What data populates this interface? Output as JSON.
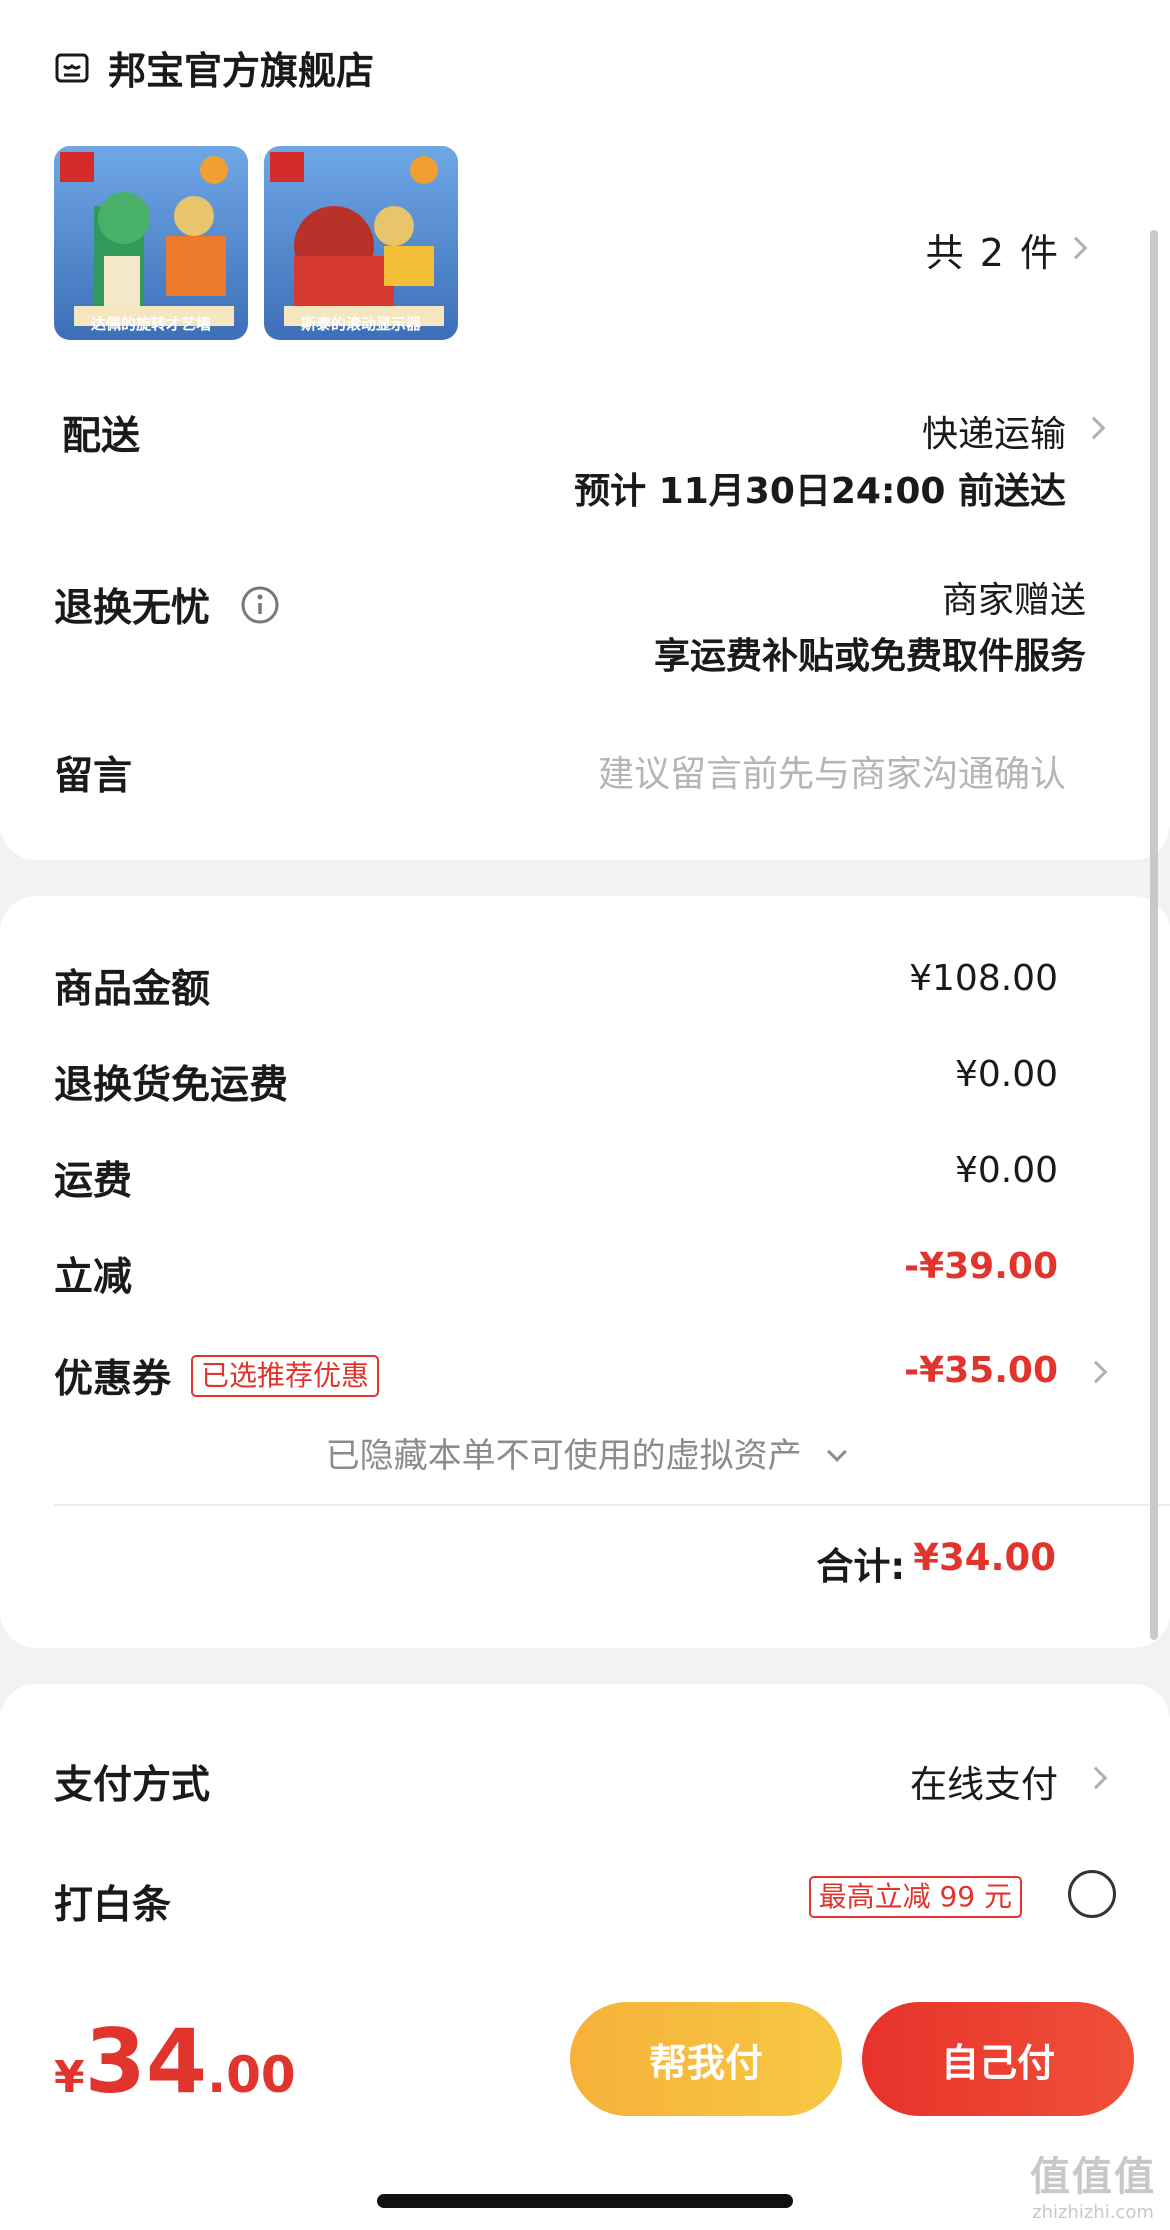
{
  "store": {
    "name": "邦宝官方旗舰店",
    "icon": "store-icon"
  },
  "products": {
    "items": [
      {
        "caption": "达佩的旋转才艺墙",
        "bg": "#4a7fc4"
      },
      {
        "caption": "斯泰的滚动显示器",
        "bg": "#4a7fc4"
      }
    ],
    "count_label": "共",
    "count": "2",
    "count_unit": "件"
  },
  "delivery": {
    "label": "配送",
    "method": "快递运输",
    "eta": "预计 11月30日24:00 前送达"
  },
  "returns": {
    "label": "退换无忧",
    "value": "商家赠送",
    "desc": "享运费补贴或免费取件服务"
  },
  "message": {
    "label": "留言",
    "placeholder": "建议留言前先与商家沟通确认"
  },
  "price": {
    "goods_label": "商品金额",
    "goods_value": "¥108.00",
    "return_ship_label": "退换货免运费",
    "return_ship_value": "¥0.00",
    "shipping_label": "运费",
    "shipping_value": "¥0.00",
    "discount_label": "立减",
    "discount_value": "-¥39.00",
    "coupon_label": "优惠券",
    "coupon_tag": "已选推荐优惠",
    "coupon_value": "-¥35.00",
    "hidden_assets": "已隐藏本单不可使用的虚拟资产",
    "total_label": "合计:",
    "total_value": "¥34.00"
  },
  "payment": {
    "label": "支付方式",
    "value": "在线支付",
    "baitiao_label": "打白条",
    "baitiao_tag": "最高立减 99 元"
  },
  "bottom": {
    "currency": "¥",
    "amount_int": "34",
    "amount_dec": ".00",
    "help_pay": "帮我付",
    "self_pay": "自己付"
  },
  "watermark": {
    "logo": "值值值",
    "url": "zhizhizhi.com"
  },
  "colors": {
    "accent_red": "#e0342d",
    "help_pay_start": "#f7b733",
    "self_pay_start": "#f2452d"
  }
}
